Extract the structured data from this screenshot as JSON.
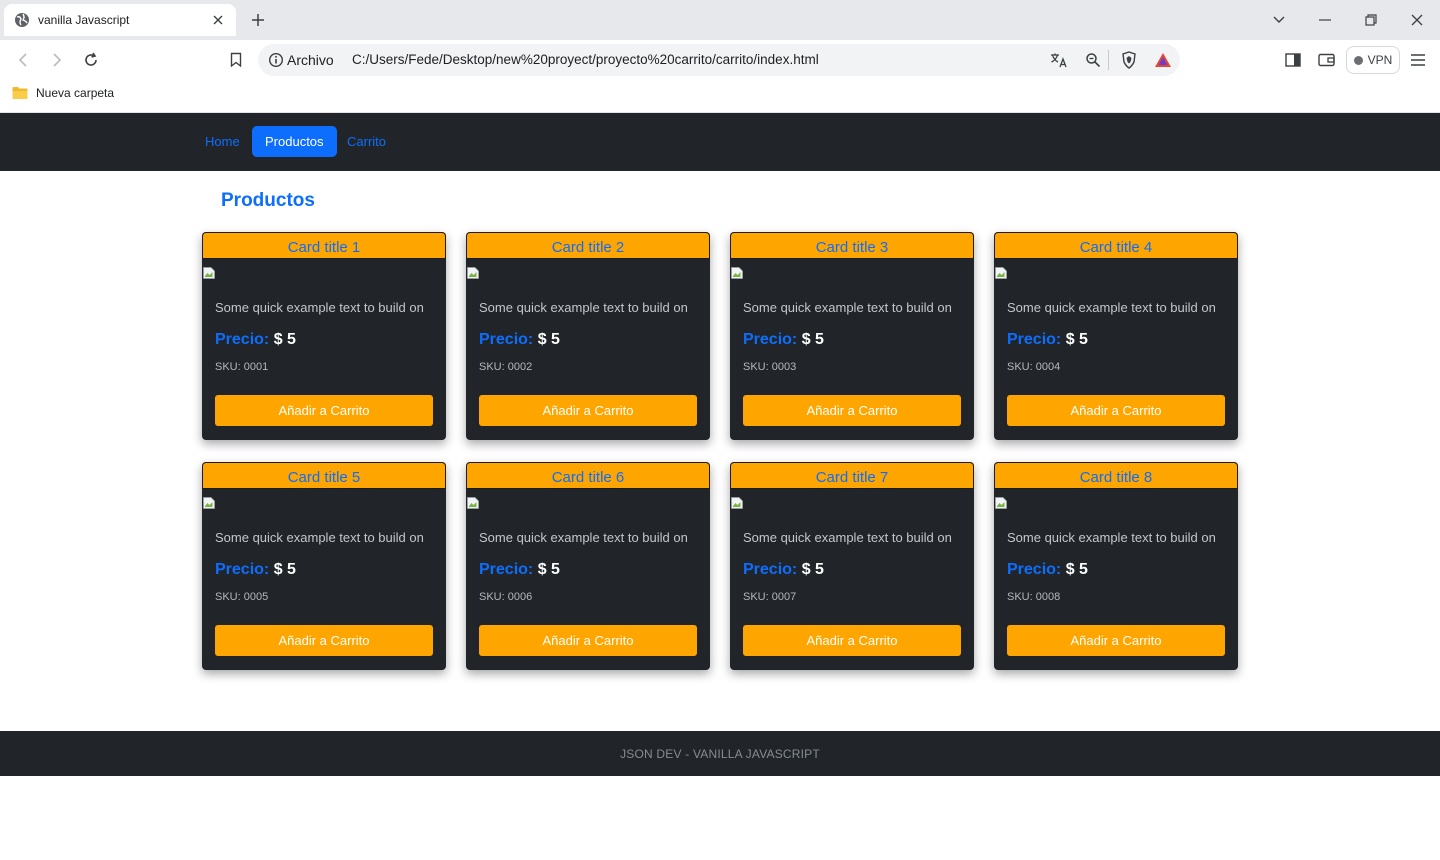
{
  "browser": {
    "tab_title": "vanilla Javascript",
    "scheme_label": "Archivo",
    "url": "C:/Users/Fede/Desktop/new%20proyect/proyecto%20carrito/carrito/index.html",
    "vpn_label": "VPN",
    "bookmark_folder": "Nueva carpeta"
  },
  "nav": {
    "items": [
      {
        "label": "Home"
      },
      {
        "label": "Productos"
      },
      {
        "label": "Carrito"
      }
    ],
    "active": "Productos"
  },
  "page": {
    "heading": "Productos"
  },
  "products": [
    {
      "title": "Card title 1",
      "text": "Some quick example text to build on",
      "price_label": "Precio:",
      "price": "$ 5",
      "sku": "SKU: 0001",
      "button": "Añadir a Carrito"
    },
    {
      "title": "Card title 2",
      "text": "Some quick example text to build on",
      "price_label": "Precio:",
      "price": "$ 5",
      "sku": "SKU: 0002",
      "button": "Añadir a Carrito"
    },
    {
      "title": "Card title 3",
      "text": "Some quick example text to build on",
      "price_label": "Precio:",
      "price": "$ 5",
      "sku": "SKU: 0003",
      "button": "Añadir a Carrito"
    },
    {
      "title": "Card title 4",
      "text": "Some quick example text to build on",
      "price_label": "Precio:",
      "price": "$ 5",
      "sku": "SKU: 0004",
      "button": "Añadir a Carrito"
    },
    {
      "title": "Card title 5",
      "text": "Some quick example text to build on",
      "price_label": "Precio:",
      "price": "$ 5",
      "sku": "SKU: 0005",
      "button": "Añadir a Carrito"
    },
    {
      "title": "Card title 6",
      "text": "Some quick example text to build on",
      "price_label": "Precio:",
      "price": "$ 5",
      "sku": "SKU: 0006",
      "button": "Añadir a Carrito"
    },
    {
      "title": "Card title 7",
      "text": "Some quick example text to build on",
      "price_label": "Precio:",
      "price": "$ 5",
      "sku": "SKU: 0007",
      "button": "Añadir a Carrito"
    },
    {
      "title": "Card title 8",
      "text": "Some quick example text to build on",
      "price_label": "Precio:",
      "price": "$ 5",
      "sku": "SKU: 0008",
      "button": "Añadir a Carrito"
    }
  ],
  "footer": {
    "text": "JSON DEV - VANILLA JAVASCRIPT"
  },
  "colors": {
    "navbar": "#212529",
    "accent_blue": "#0d6efd",
    "card_accent": "#ffa500",
    "card_body": "#212529"
  },
  "icons": [
    "globe-icon",
    "close-icon",
    "plus-icon",
    "chevron-down-icon",
    "minimize-icon",
    "restore-icon",
    "back-icon",
    "forward-icon",
    "reload-icon",
    "bookmark-icon",
    "info-icon",
    "translate-icon",
    "zoom-icon",
    "brave-shield-icon",
    "brave-rewards-icon",
    "sidebar-icon",
    "wallet-icon",
    "menu-icon",
    "folder-icon",
    "broken-image-icon"
  ]
}
